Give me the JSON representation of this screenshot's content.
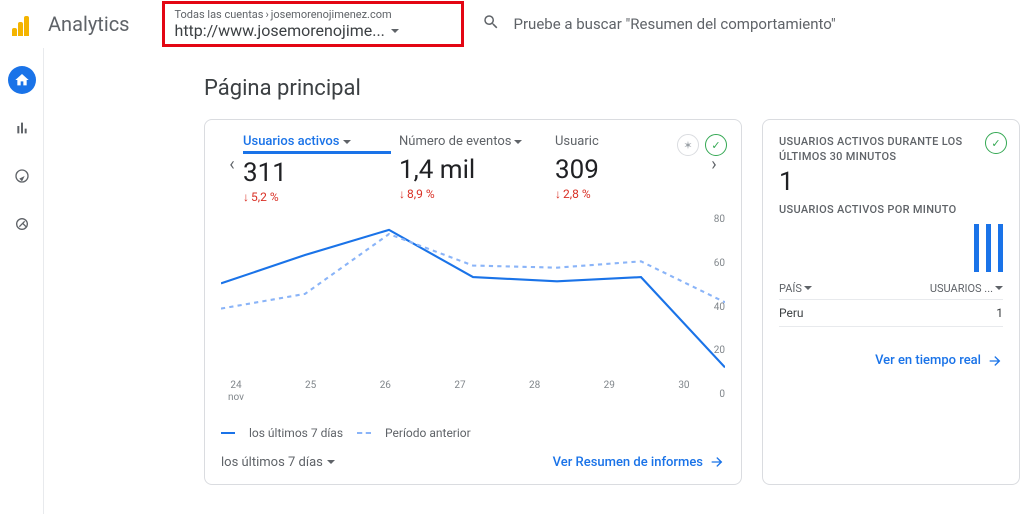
{
  "brand": "Analytics",
  "property": {
    "crumb_root": "Todas las cuentas",
    "crumb_leaf": "josemorenojimenez.com",
    "url": "http://www.josemorenojime..."
  },
  "search": {
    "placeholder": "Pruebe a buscar \"Resumen del comportamiento\""
  },
  "page_title": "Página principal",
  "overview": {
    "metrics": [
      {
        "label": "Usuarios activos",
        "value": "311",
        "delta": "5,2 %"
      },
      {
        "label": "Número de eventos",
        "value": "1,4 mil",
        "delta": "8,9 %"
      },
      {
        "label": "Usuaric",
        "value": "309",
        "delta": "2,8 %"
      }
    ],
    "legend_current": "los últimos 7 días",
    "legend_prev": "Período anterior",
    "range_label": "los últimos 7 días",
    "link": "Ver Resumen de informes",
    "x_labels": [
      "24",
      "25",
      "26",
      "27",
      "28",
      "29",
      "30"
    ],
    "x_sub": "nov",
    "y_ticks": [
      "80",
      "60",
      "40",
      "20",
      "0"
    ]
  },
  "realtime": {
    "title": "USUARIOS ACTIVOS DURANTE LOS ÚLTIMOS 30 MINUTOS",
    "value": "1",
    "subtitle": "USUARIOS ACTIVOS POR MINUTO",
    "col_country": "PAÍS",
    "col_users": "USUARIOS ...",
    "rows": [
      {
        "country": "Peru",
        "users": "1"
      }
    ],
    "link": "Ver en tiempo real"
  },
  "chart_data": {
    "type": "line",
    "x": [
      "24 nov",
      "25",
      "26",
      "27",
      "28",
      "29",
      "30"
    ],
    "series": [
      {
        "name": "los últimos 7 días",
        "values": [
          47,
          60,
          72,
          50,
          48,
          50,
          8
        ]
      },
      {
        "name": "Período anterior",
        "values": [
          35,
          42,
          70,
          55,
          54,
          57,
          38
        ]
      }
    ],
    "title": "Usuarios activos",
    "ylabel": "",
    "xlabel": "",
    "ylim": [
      0,
      80
    ]
  }
}
